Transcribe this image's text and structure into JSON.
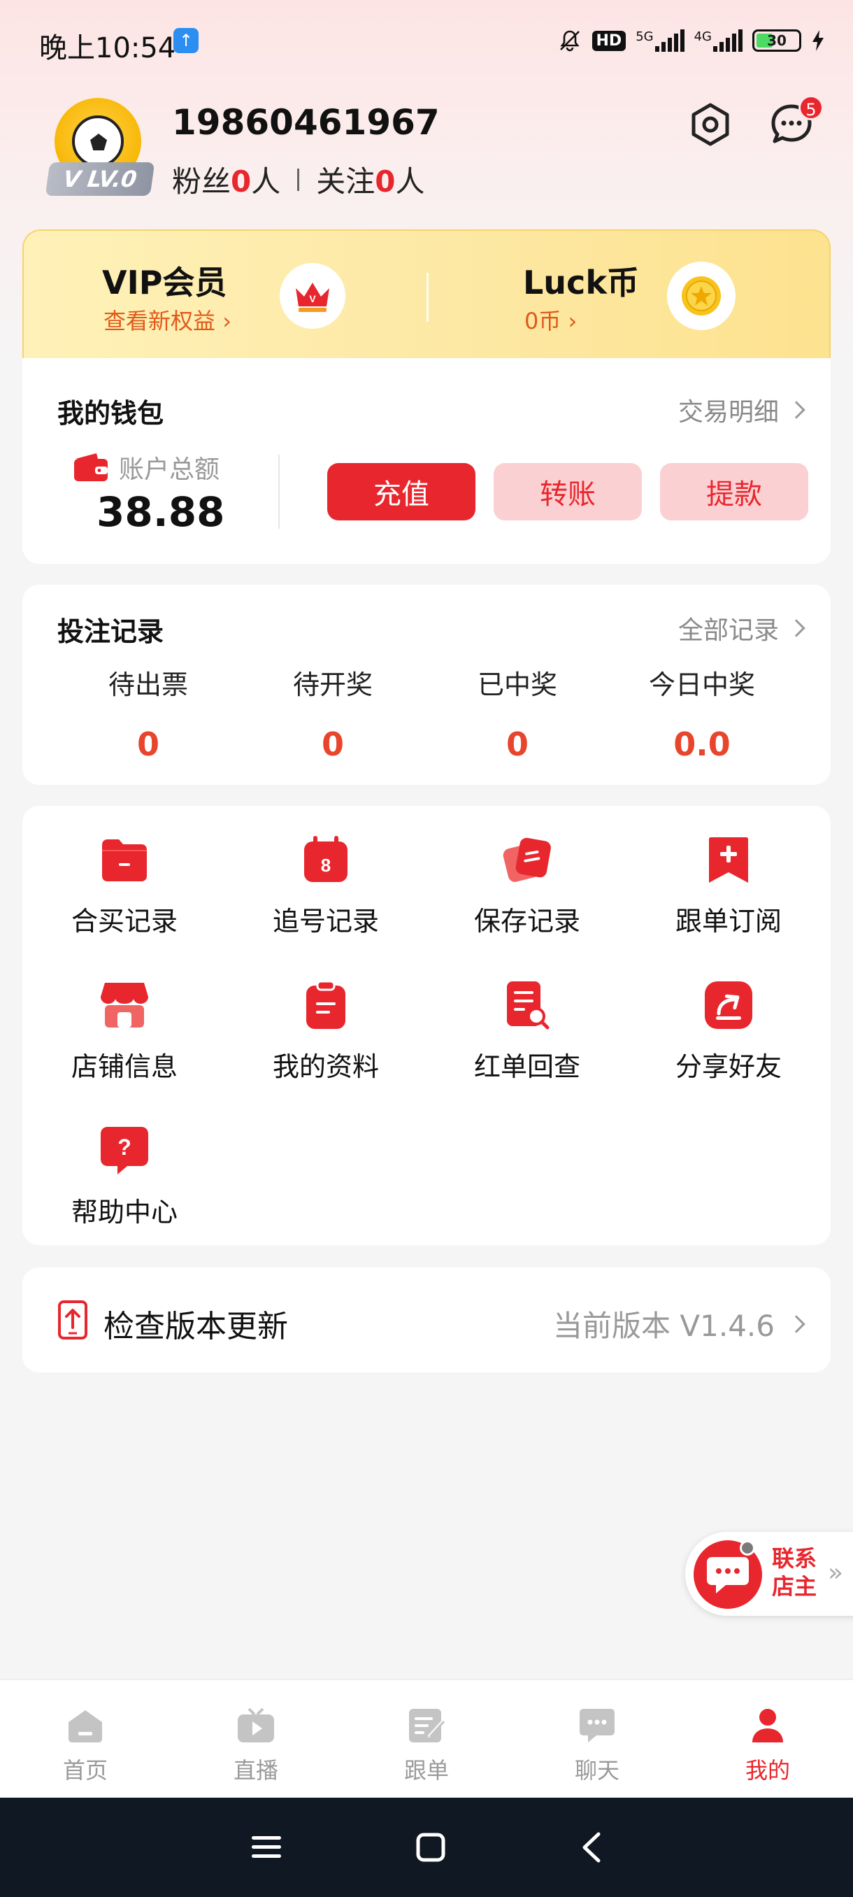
{
  "status_bar": {
    "time": "晚上10:54",
    "hd_label": "HD",
    "net_5g": "5G",
    "net_4g": "4G",
    "battery": "30"
  },
  "profile": {
    "phone": "19860461967",
    "level": "LV.0",
    "fans_label": "粉丝",
    "fans_count": "0",
    "fans_unit": "人",
    "follow_label": "关注",
    "follow_count": "0",
    "follow_unit": "人",
    "message_badge": "5"
  },
  "vip": {
    "title": "VIP会员",
    "subtitle": "查看新权益",
    "luck_title": "Luck币",
    "luck_subtitle": "0币"
  },
  "wallet": {
    "title": "我的钱包",
    "link": "交易明细",
    "balance_label": "账户总额",
    "balance": "38.88",
    "recharge": "充值",
    "transfer": "转账",
    "withdraw": "提款"
  },
  "bets": {
    "title": "投注记录",
    "link": "全部记录",
    "stats": [
      {
        "label": "待出票",
        "value": "0"
      },
      {
        "label": "待开奖",
        "value": "0"
      },
      {
        "label": "已中奖",
        "value": "0"
      },
      {
        "label": "今日中奖",
        "value": "0.0"
      }
    ]
  },
  "menu": [
    {
      "label": "合买记录",
      "icon": "folder-icon"
    },
    {
      "label": "追号记录",
      "icon": "calendar-icon"
    },
    {
      "label": "保存记录",
      "icon": "cards-icon"
    },
    {
      "label": "跟单订阅",
      "icon": "bookmark-icon"
    },
    {
      "label": "店铺信息",
      "icon": "shop-icon"
    },
    {
      "label": "我的资料",
      "icon": "clipboard-icon"
    },
    {
      "label": "红单回查",
      "icon": "doc-search-icon"
    },
    {
      "label": "分享好友",
      "icon": "share-icon"
    },
    {
      "label": "帮助中心",
      "icon": "help-icon"
    }
  ],
  "update": {
    "title": "检查版本更新",
    "version": "当前版本 V1.4.6"
  },
  "contact": {
    "line1": "联系",
    "line2": "店主"
  },
  "tabs": [
    {
      "label": "首页",
      "icon": "home-icon"
    },
    {
      "label": "直播",
      "icon": "live-icon"
    },
    {
      "label": "跟单",
      "icon": "follow-order-icon"
    },
    {
      "label": "聊天",
      "icon": "chat-icon"
    },
    {
      "label": "我的",
      "icon": "person-icon",
      "active": true
    }
  ],
  "colors": {
    "accent": "#e8262d",
    "soft_accent": "#fbd0d3",
    "vip_gold": "#fde9a6",
    "muted": "#999999"
  }
}
